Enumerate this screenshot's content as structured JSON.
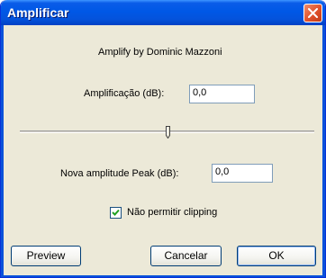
{
  "window": {
    "title": "Amplificar"
  },
  "header": {
    "credit": "Amplify by Dominic Mazzoni"
  },
  "amplification": {
    "label": "Amplificação (dB):",
    "value": "0,0"
  },
  "slider": {
    "position_fraction": 0.5
  },
  "peak": {
    "label": "Nova amplitude Peak (dB):",
    "value": "0,0"
  },
  "clipping": {
    "label": "Não permitir clipping",
    "checked": true
  },
  "buttons": {
    "preview": "Preview",
    "cancel": "Cancelar",
    "ok": "OK"
  },
  "icons": {
    "close": "close-icon",
    "check": "checkmark-icon",
    "slider_thumb": "slider-thumb"
  },
  "colors": {
    "titlebar": "#0058e6",
    "close_button": "#e0502a",
    "dialog_background": "#ece9d8",
    "button_border": "#003c74"
  }
}
